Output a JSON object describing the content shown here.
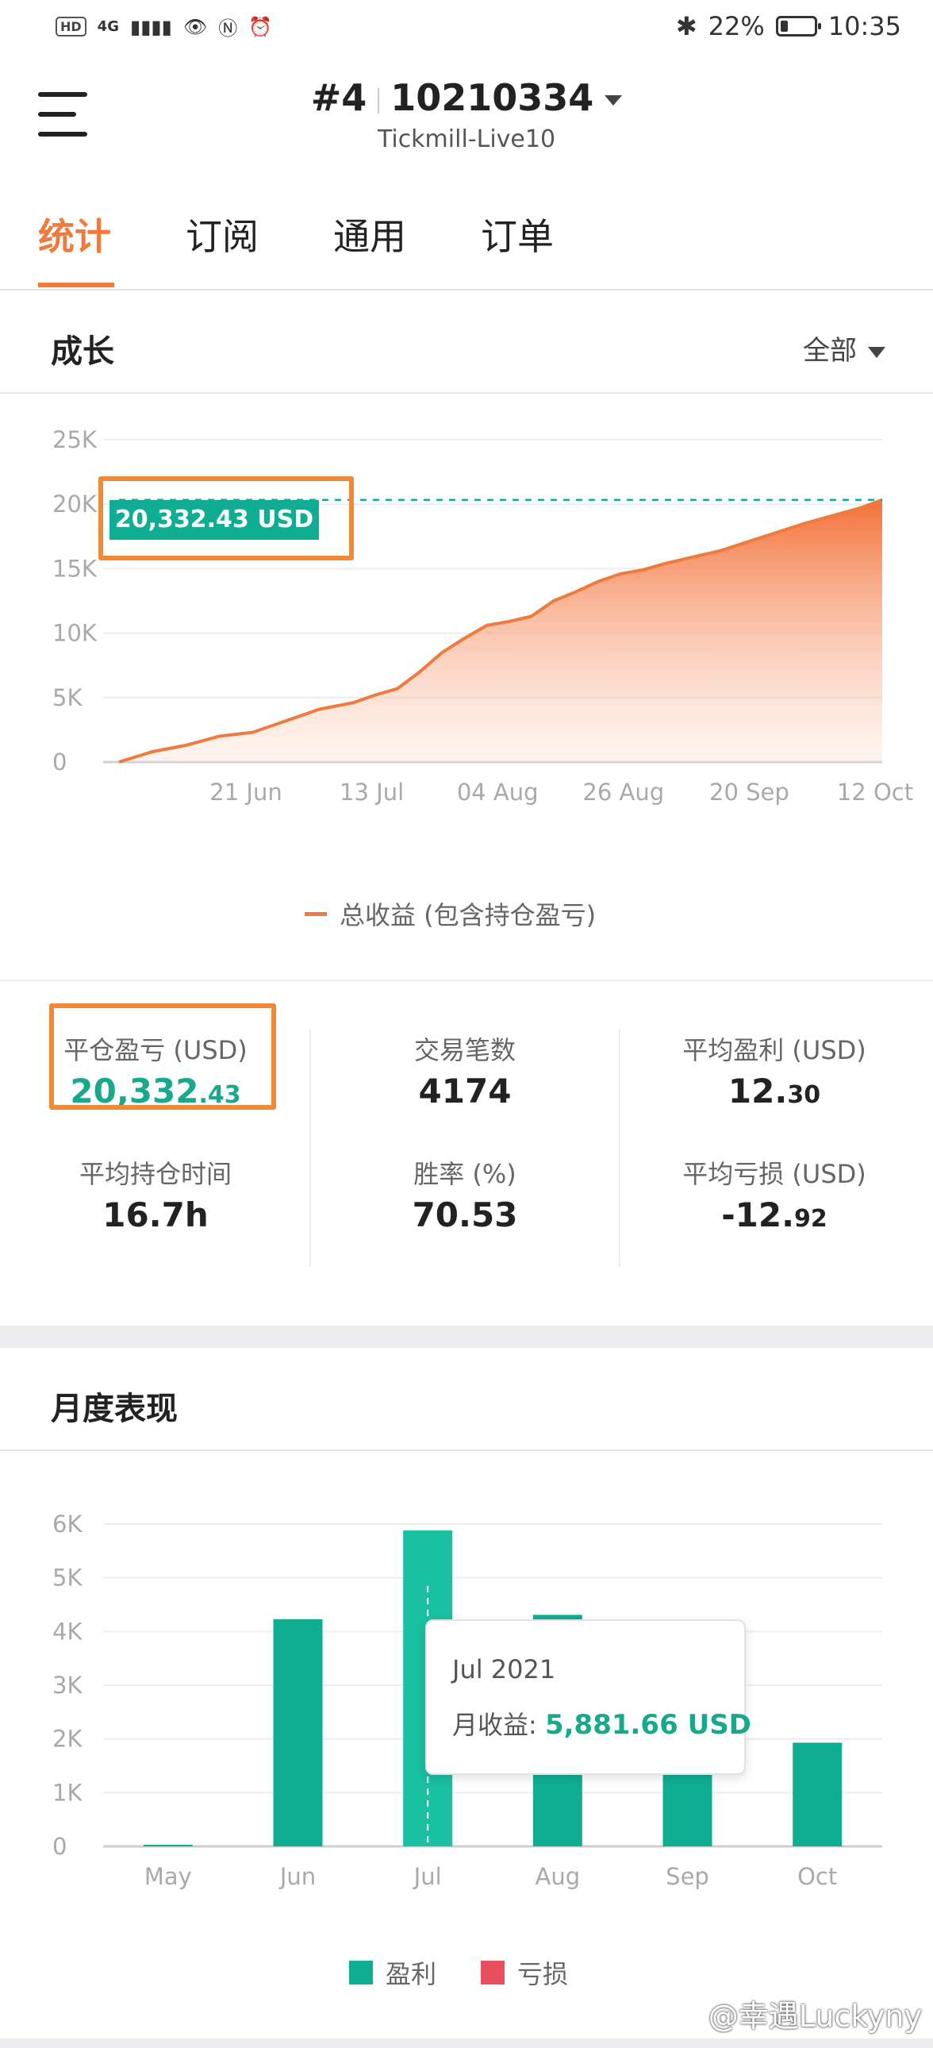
{
  "status_bar": {
    "badge": "HD",
    "network": "4G",
    "battery": "22%",
    "battery_level": 0.22,
    "time": "10:35"
  },
  "header": {
    "account_prefix": "#4",
    "account_id": "10210334",
    "server": "Tickmill-Live10"
  },
  "tabs": [
    "统计",
    "订阅",
    "通用",
    "订单"
  ],
  "growth": {
    "title": "成长",
    "filter": "全部",
    "callout": "20,332.43 USD",
    "legend": "总收益 (包含持仓盈亏)"
  },
  "stats": [
    {
      "label": "平仓盈亏 (USD)",
      "value_main": "20,332",
      "value_small": ".43"
    },
    {
      "label": "交易笔数",
      "value_main": "4174",
      "value_small": ""
    },
    {
      "label": "平均盈利 (USD)",
      "value_main": "12.",
      "value_small": "30"
    },
    {
      "label": "平均持仓时间",
      "value_main": "16.7h",
      "value_small": ""
    },
    {
      "label": "胜率 (%)",
      "value_main": "70.53",
      "value_small": ""
    },
    {
      "label": "平均亏损 (USD)",
      "value_main": "-12.",
      "value_small": "92"
    }
  ],
  "monthly": {
    "title": "月度表现",
    "tooltip": {
      "title": "Jul 2021",
      "label": "月收益:",
      "value": "5,881.66 USD"
    },
    "legend": [
      {
        "name": "盈利",
        "color": "#0fae92"
      },
      {
        "name": "亏损",
        "color": "#e8505f"
      }
    ]
  },
  "watermark": "@幸遇Luckyny",
  "chart_data": [
    {
      "type": "area",
      "title": "成长",
      "x_tick_labels": [
        "21 Jun",
        "13 Jul",
        "04 Aug",
        "26 Aug",
        "20 Sep",
        "12 Oct"
      ],
      "y_tick_labels": [
        "0",
        "5K",
        "10K",
        "15K",
        "20K",
        "25K"
      ],
      "ylim": [
        0,
        25000
      ],
      "series": [
        {
          "name": "总收益 (包含持仓盈亏)",
          "x": [
            "2021-05-28",
            "2021-06-03",
            "2021-06-09",
            "2021-06-15",
            "2021-06-21",
            "2021-06-27",
            "2021-07-03",
            "2021-07-09",
            "2021-07-13",
            "2021-07-17",
            "2021-07-21",
            "2021-07-25",
            "2021-07-29",
            "2021-08-02",
            "2021-08-06",
            "2021-08-10",
            "2021-08-14",
            "2021-08-18",
            "2021-08-22",
            "2021-08-26",
            "2021-08-30",
            "2021-09-03",
            "2021-09-08",
            "2021-09-13",
            "2021-09-18",
            "2021-09-23",
            "2021-09-28",
            "2021-10-03",
            "2021-10-08",
            "2021-10-12"
          ],
          "values": [
            0,
            800,
            1300,
            2000,
            2300,
            3200,
            4100,
            4600,
            5200,
            5700,
            7000,
            8500,
            9600,
            10600,
            10900,
            11300,
            12500,
            13200,
            14000,
            14600,
            14900,
            15400,
            15900,
            16400,
            17100,
            17800,
            18500,
            19100,
            19700,
            20332.43
          ],
          "color": "#f07a3c"
        }
      ],
      "reference_line": 20332.43,
      "grid": "horizontal"
    },
    {
      "type": "bar",
      "title": "月度表现",
      "categories": [
        "May",
        "Jun",
        "Jul",
        "Aug",
        "Sep",
        "Oct"
      ],
      "y_tick_labels": [
        "0",
        "1K",
        "2K",
        "3K",
        "4K",
        "5K",
        "6K"
      ],
      "ylim": [
        0,
        6000
      ],
      "series": [
        {
          "name": "盈利",
          "values": [
            30,
            4230,
            5881.66,
            4310,
            3900,
            1930
          ],
          "color": "#0fae92"
        },
        {
          "name": "亏损",
          "values": [
            0,
            0,
            0,
            0,
            0,
            0
          ],
          "color": "#e8505f"
        }
      ],
      "highlighted": "Jul",
      "grid": "horizontal",
      "legend": "bottom"
    }
  ]
}
